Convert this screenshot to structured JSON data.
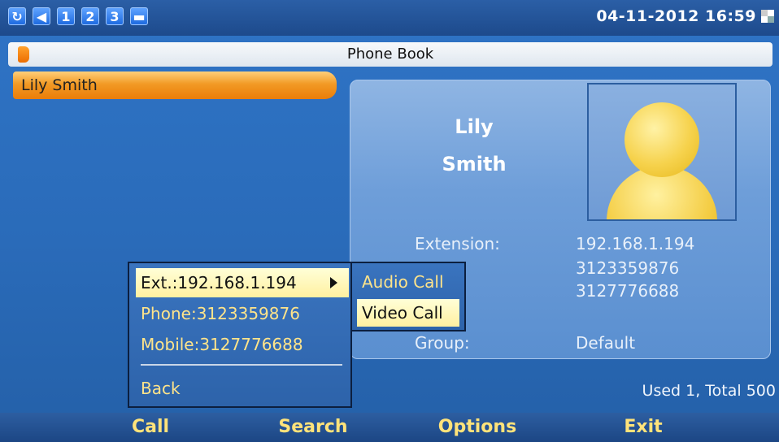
{
  "status_bar": {
    "icons": [
      {
        "name": "sync-icon",
        "glyph": "↻"
      },
      {
        "name": "speaker-icon",
        "glyph": "◀"
      },
      {
        "name": "line-1-icon",
        "glyph": "1"
      },
      {
        "name": "line-2-icon",
        "glyph": "2"
      },
      {
        "name": "line-3-icon",
        "glyph": "3"
      },
      {
        "name": "folder-icon",
        "glyph": "▬"
      }
    ],
    "datetime": "04-11-2012 16:59"
  },
  "title": "Phone Book",
  "contacts": [
    "Lily Smith"
  ],
  "detail": {
    "first_name": "Lily",
    "last_name": "Smith",
    "extension_label": "Extension:",
    "extension_value": "192.168.1.194",
    "phone_value": "3123359876",
    "mobile_value": "3127776688",
    "group_label": "Group:",
    "group_value": "Default"
  },
  "usage": "Used 1, Total 500",
  "call_menu": {
    "items": [
      "Ext.:192.168.1.194",
      "Phone:3123359876",
      "Mobile:3127776688"
    ],
    "back": "Back",
    "submenu": [
      "Audio Call",
      "Video Call"
    ]
  },
  "softkeys": [
    "Call",
    "Search",
    "Options",
    "Exit"
  ],
  "colors": {
    "background": "#2a6bb9",
    "menu_text": "#ffe48a",
    "selected_highlight": "#fff0a0",
    "softkey_text": "#ffe37a",
    "contact_highlight": "#f29a25"
  }
}
